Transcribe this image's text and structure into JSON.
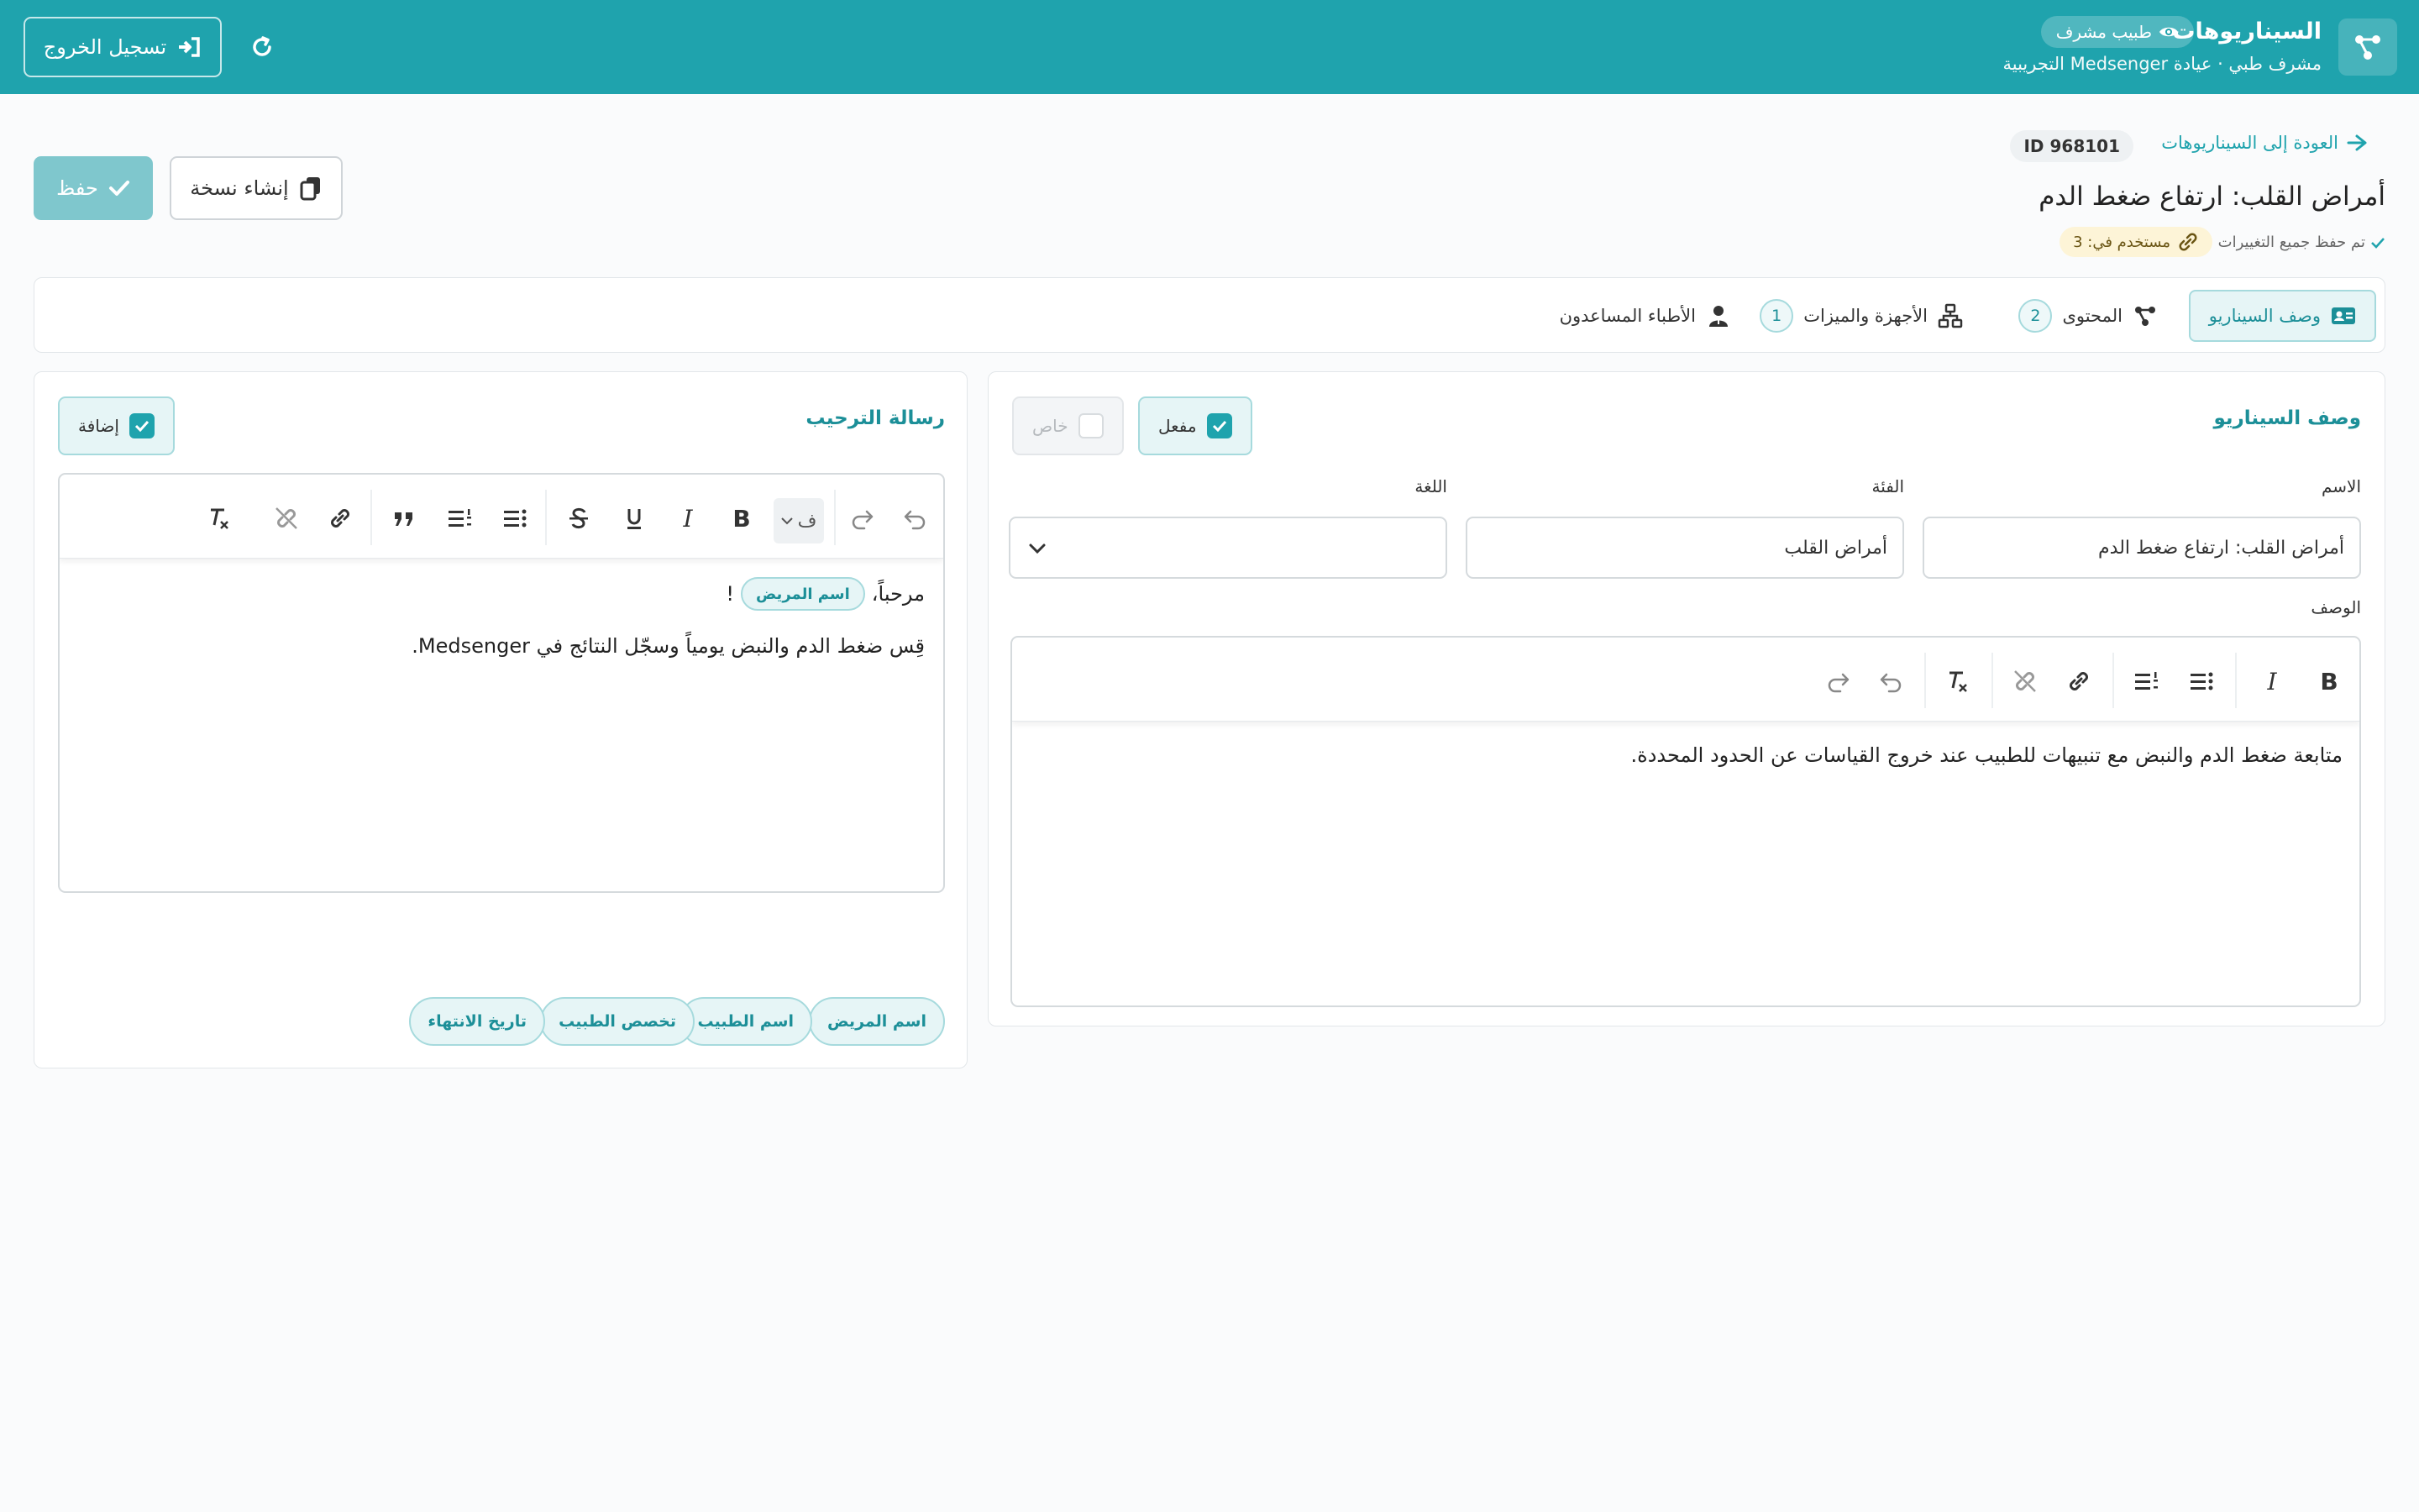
{
  "header": {
    "app_title": "السيناريوهات",
    "role_badge": "طبيب مشرف",
    "subtitle": "مشرف طبي · عيادة Medsenger التجريبية",
    "logout_label": "تسجيل الخروج"
  },
  "page": {
    "back_label": "العودة إلى السيناريوهات",
    "id_badge": "ID 968101",
    "title": "أمراض القلب: ارتفاع ضغط الدم",
    "save_status": "تم حفظ جميع التغييرات",
    "usage_badge": "مستخدم في: 3",
    "save_label": "حفظ",
    "copy_label": "إنشاء نسخة"
  },
  "tabs": [
    {
      "label": "وصف السيناريو",
      "active": true
    },
    {
      "label": "المحتوى",
      "count": "2"
    },
    {
      "label": "الأجهزة والميزات",
      "count": "1"
    },
    {
      "label": "الأطباء المساعدون"
    }
  ],
  "description_card": {
    "title": "وصف السيناريو",
    "enabled_label": "مفعل",
    "enabled": true,
    "private_label": "خاص",
    "private": false,
    "name_label": "الاسم",
    "name_value": "أمراض القلب: ارتفاع ضغط الدم",
    "category_label": "الفئة",
    "category_value": "أمراض القلب",
    "language_label": "اللغة",
    "language_value": "",
    "description_label": "الوصف",
    "description_text": "متابعة ضغط الدم والنبض مع تنبيهات للطبيب عند خروج القياسات عن الحدود المحددة."
  },
  "welcome_card": {
    "title": "رسالة الترحيب",
    "add_label": "إضافة",
    "add_checked": true,
    "font_button": "ف",
    "line1_prefix": "مرحباً،",
    "line1_chip": "اسم المريض",
    "line1_suffix": "!",
    "line2": "قِس ضغط الدم والنبض يومياً وسجّل النتائج في Medsenger.",
    "variables": [
      "اسم المريض",
      "اسم الطبيب",
      "تخصص الطبيب",
      "تاريخ الانتهاء"
    ]
  },
  "colors": {
    "primary": "#1fa3ad",
    "primary_light": "#e6f5f6",
    "save_button": "#7fc7cd",
    "usage_badge_bg": "#fdf4d7"
  }
}
